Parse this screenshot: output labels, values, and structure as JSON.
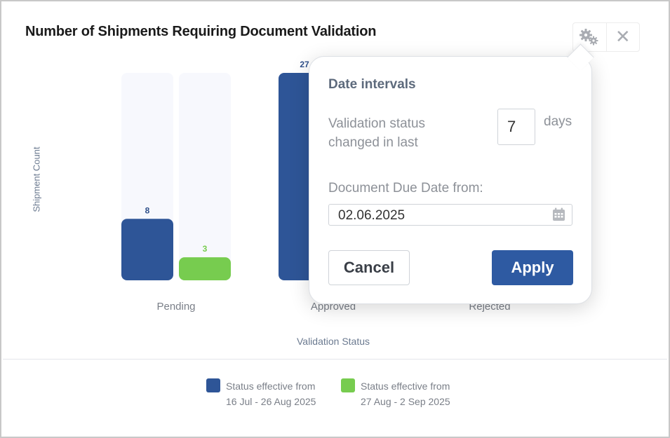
{
  "widget": {
    "title": "Number of Shipments Requiring Document Validation",
    "settings_icon": "gears-icon",
    "close_icon": "close-icon",
    "close_glyph": "✕"
  },
  "chart_data": {
    "type": "bar",
    "categories": [
      "Pending",
      "Approved",
      "Rejected"
    ],
    "series": [
      {
        "name": "Status effective from 16 Jul - 26 Aug 2025",
        "values": [
          8,
          27,
          null
        ],
        "color": "#2e5597"
      },
      {
        "name": "Status effective from 27 Aug - 2 Sep 2025",
        "values": [
          3,
          null,
          null
        ],
        "color": "#77cc4f"
      }
    ],
    "xlabel": "Validation Status",
    "ylabel": "Shipment Count",
    "ylim": [
      0,
      27
    ],
    "grid": false,
    "legend": [
      {
        "line1": "Status effective from",
        "line2": "16 Jul - 26 Aug 2025",
        "color": "#2e5597"
      },
      {
        "line1": "Status effective from",
        "line2": "27 Aug - 2 Sep 2025",
        "color": "#77cc4f"
      }
    ],
    "legend_position": "bottom",
    "track_color": "#f7f8fd",
    "label_colors": [
      "#2e4f8a",
      "#77cc4f"
    ]
  },
  "popup": {
    "heading": "Date intervals",
    "validation_label": "Validation status changed in last",
    "days_value": "7",
    "days_unit": "days",
    "due_label": "Document Due Date from:",
    "due_value": "02.06.2025",
    "calendar_icon": "calendar-icon",
    "cancel_label": "Cancel",
    "apply_label": "Apply",
    "apply_color": "#2e5aa2"
  }
}
